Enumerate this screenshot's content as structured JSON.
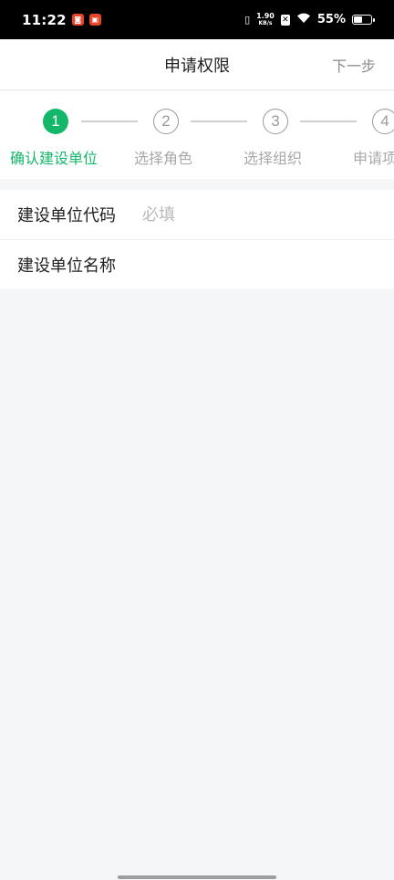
{
  "status_bar": {
    "time": "11:22",
    "net_speed_value": "1.90",
    "net_speed_unit": "KB/s",
    "battery_percent": "55%",
    "battery_level": 0.55,
    "badge_colors": [
      "#e8462b",
      "#e8462b"
    ]
  },
  "nav": {
    "title": "申请权限",
    "next_label": "下一步"
  },
  "stepper": {
    "accent_color": "#12b76a",
    "steps": [
      {
        "number": "1",
        "label": "确认建设单位",
        "active": true
      },
      {
        "number": "2",
        "label": "选择角色",
        "active": false
      },
      {
        "number": "3",
        "label": "选择组织",
        "active": false
      },
      {
        "number": "4",
        "label": "申请项",
        "active": false
      }
    ]
  },
  "form": {
    "fields": [
      {
        "label": "建设单位代码",
        "value": "",
        "placeholder": "必填"
      },
      {
        "label": "建设单位名称",
        "value": "",
        "placeholder": ""
      }
    ]
  }
}
